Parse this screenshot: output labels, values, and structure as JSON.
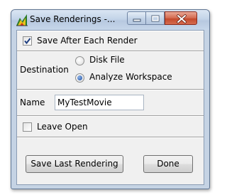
{
  "window": {
    "title": "Save Renderings -...",
    "app_icon": "chart-app-icon",
    "controls": {
      "minimize": "minimize-icon",
      "maximize": "maximize-icon",
      "close": "close-icon"
    }
  },
  "save_after_each_render": {
    "label": "Save After Each Render",
    "checked": true
  },
  "destination": {
    "label": "Destination",
    "options": [
      {
        "label": "Disk File",
        "selected": false
      },
      {
        "label": "Analyze Workspace",
        "selected": true
      }
    ]
  },
  "name_field": {
    "label": "Name",
    "value": "MyTestMovie"
  },
  "leave_open": {
    "label": "Leave Open",
    "checked": false
  },
  "buttons": {
    "save_last": "Save Last Rendering",
    "done": "Done"
  }
}
